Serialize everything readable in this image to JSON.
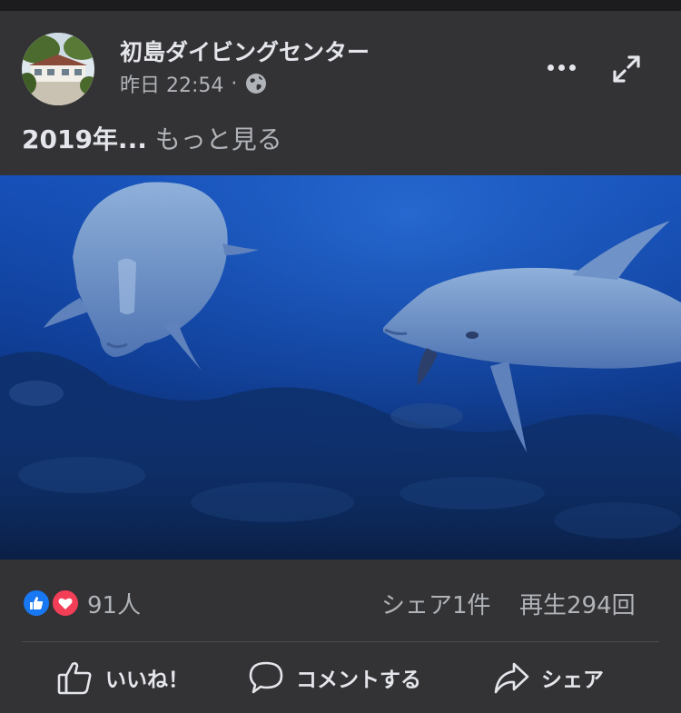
{
  "post": {
    "page_name": "初島ダイビングセンター",
    "timestamp": "昨日 22:54",
    "separator": "·",
    "privacy_icon": "globe-icon",
    "caption_text": "2019年...",
    "see_more": "もっと見る",
    "menu_icon": "more-dots-icon",
    "expand_icon": "expand-icon"
  },
  "video": {
    "subject": "dolphins underwater"
  },
  "stats": {
    "reaction_icons": [
      "like-icon",
      "love-icon"
    ],
    "reaction_count": "91人",
    "shares": "シェア1件",
    "views": "再生294回"
  },
  "actions": {
    "like_label": "いいね！",
    "comment_label": "コメントする",
    "share_label": "シェア"
  },
  "colors": {
    "background": "#333335",
    "text": "#e4e6eb",
    "muted": "#b0b3b8",
    "like_blue": "#1877f2",
    "love_red": "#f33e58"
  }
}
